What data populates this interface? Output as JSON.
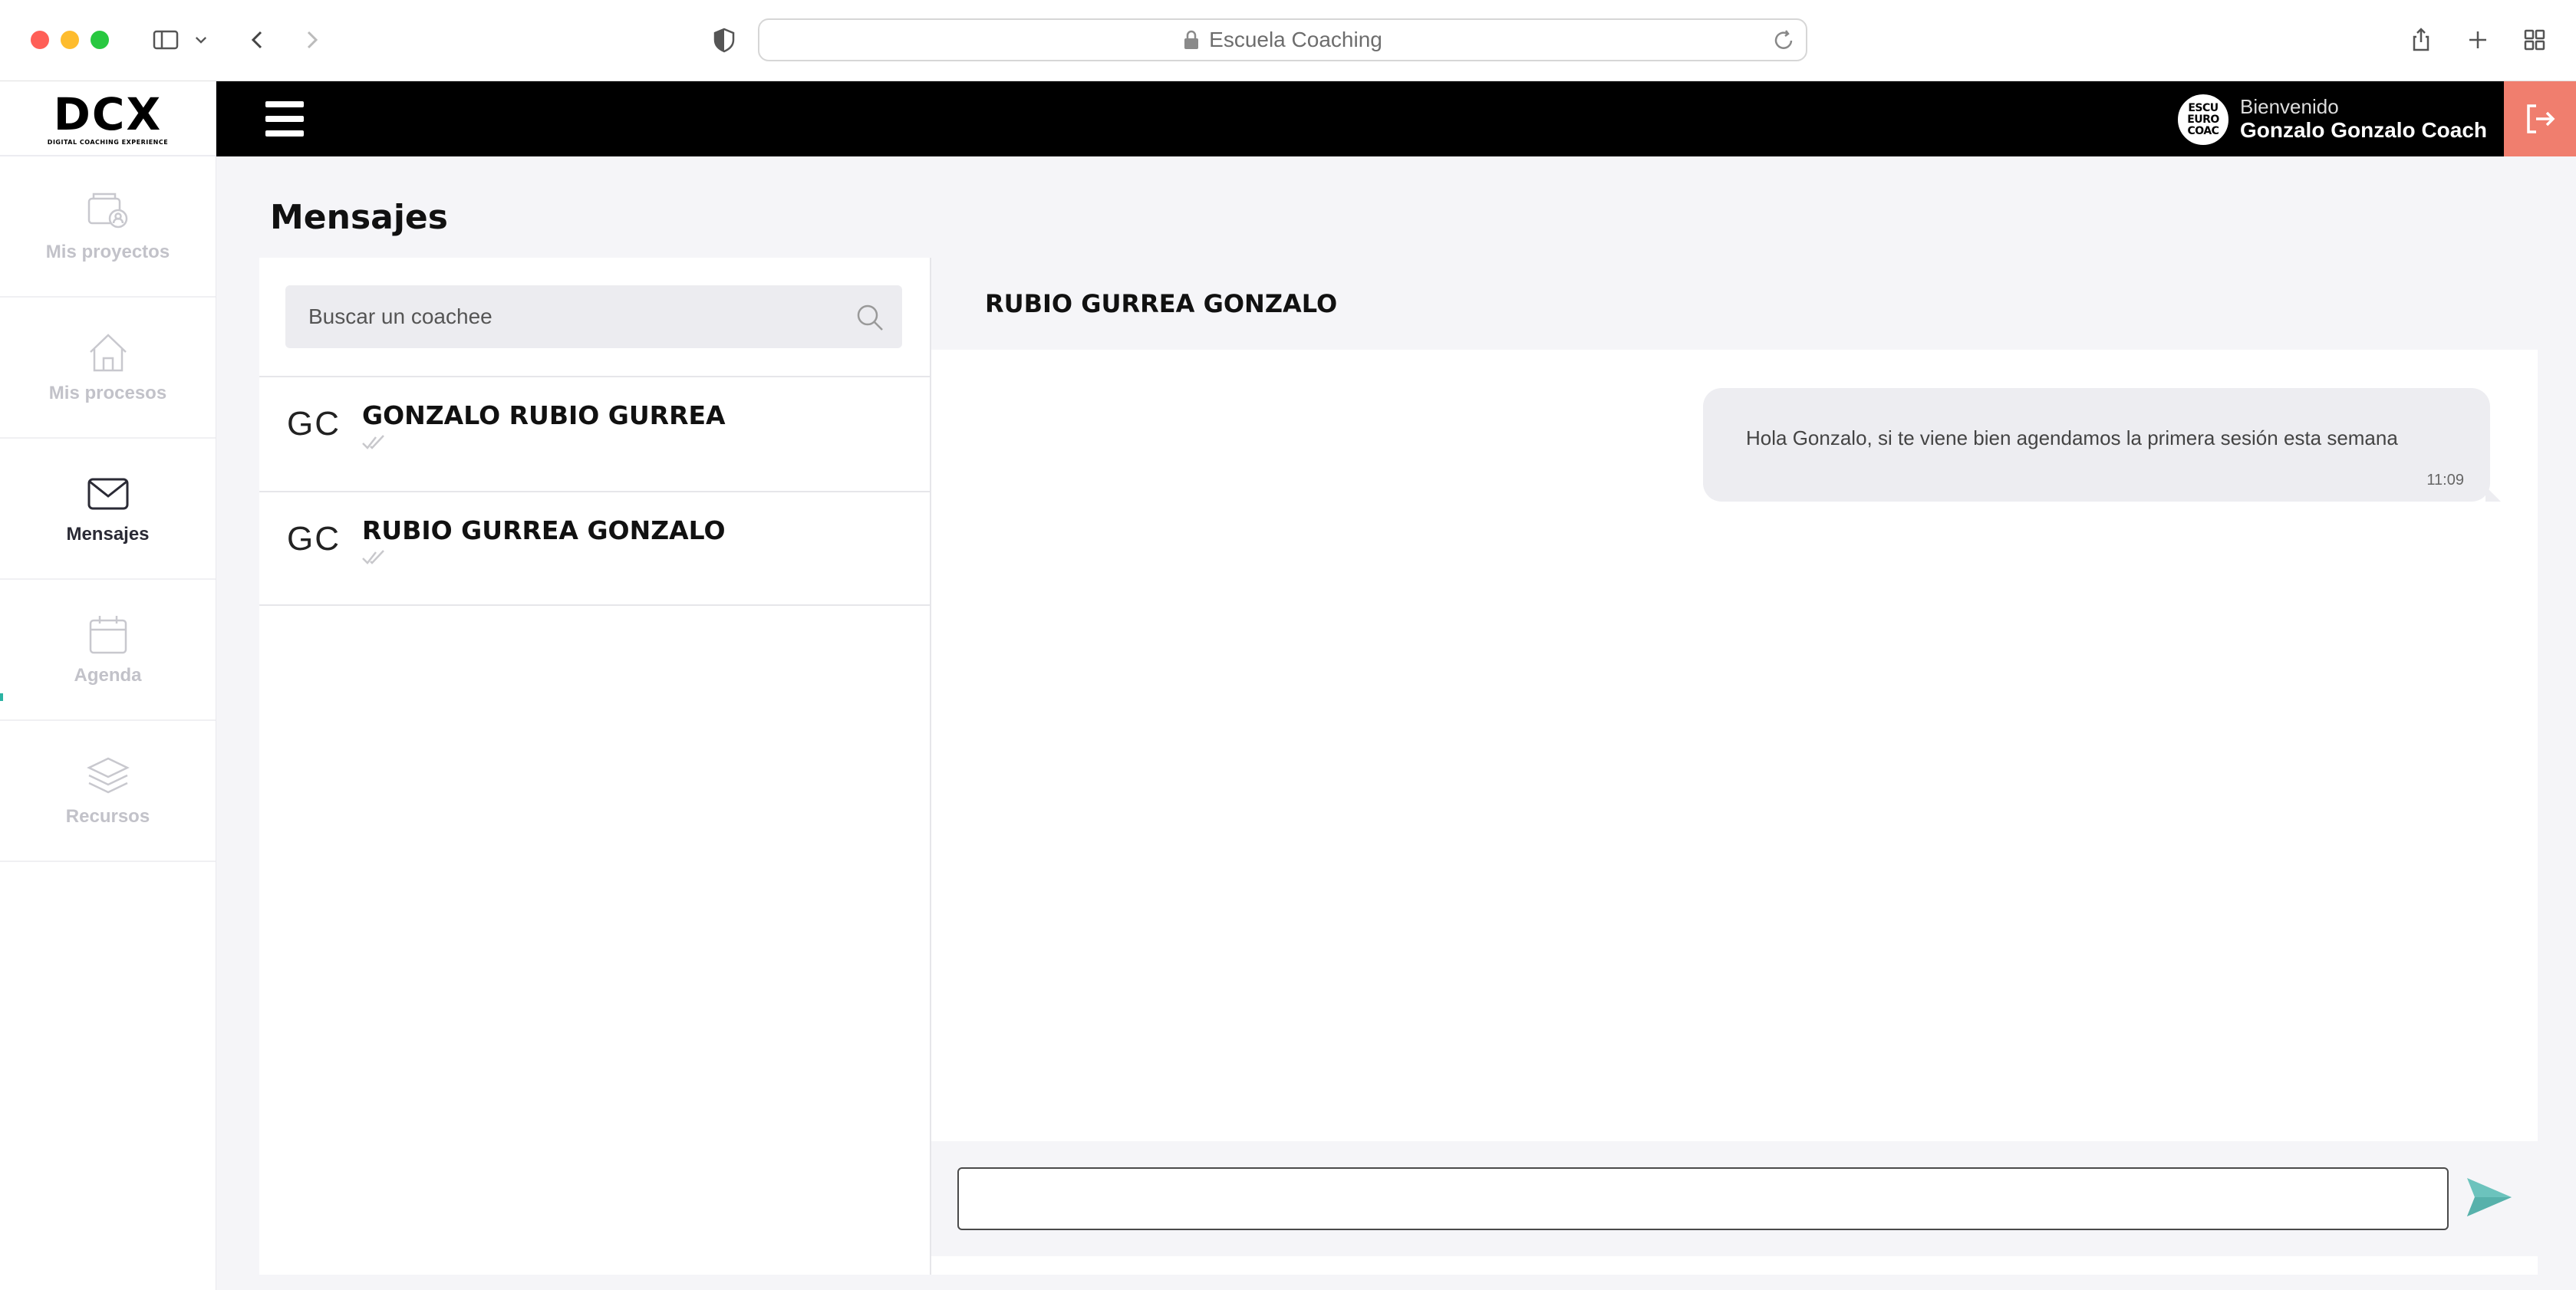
{
  "browser": {
    "url_text": "Escuela Coaching"
  },
  "app": {
    "logo": "DCX",
    "logo_tagline": "DIGITAL COACHING EXPERIENCE",
    "welcome_label": "Bienvenido",
    "user_name": "Gonzalo Gonzalo Coach",
    "avatar_text": [
      "ESCU",
      "EURO",
      "COAC"
    ],
    "accent_color": "#f07e6e",
    "send_color": "#6cc3bd"
  },
  "sidebar": {
    "items": [
      {
        "label": "Mis proyectos",
        "icon": "projects-icon",
        "active": false
      },
      {
        "label": "Mis procesos",
        "icon": "home-icon",
        "active": false
      },
      {
        "label": "Mensajes",
        "icon": "mail-icon",
        "active": true
      },
      {
        "label": "Agenda",
        "icon": "calendar-icon",
        "active": false
      },
      {
        "label": "Recursos",
        "icon": "layers-icon",
        "active": false
      }
    ]
  },
  "page": {
    "title": "Mensajes"
  },
  "search": {
    "placeholder": "Buscar un coachee"
  },
  "contacts": [
    {
      "initials": "GC",
      "name": "GONZALO RUBIO GURREA"
    },
    {
      "initials": "GC",
      "name": "RUBIO GURREA GONZALO"
    }
  ],
  "chat": {
    "header_name": "RUBIO GURREA GONZALO",
    "messages": [
      {
        "text": "Hola Gonzalo, si te viene bien agendamos la primera sesión esta semana",
        "time": "11:09"
      }
    ],
    "composer_value": ""
  }
}
